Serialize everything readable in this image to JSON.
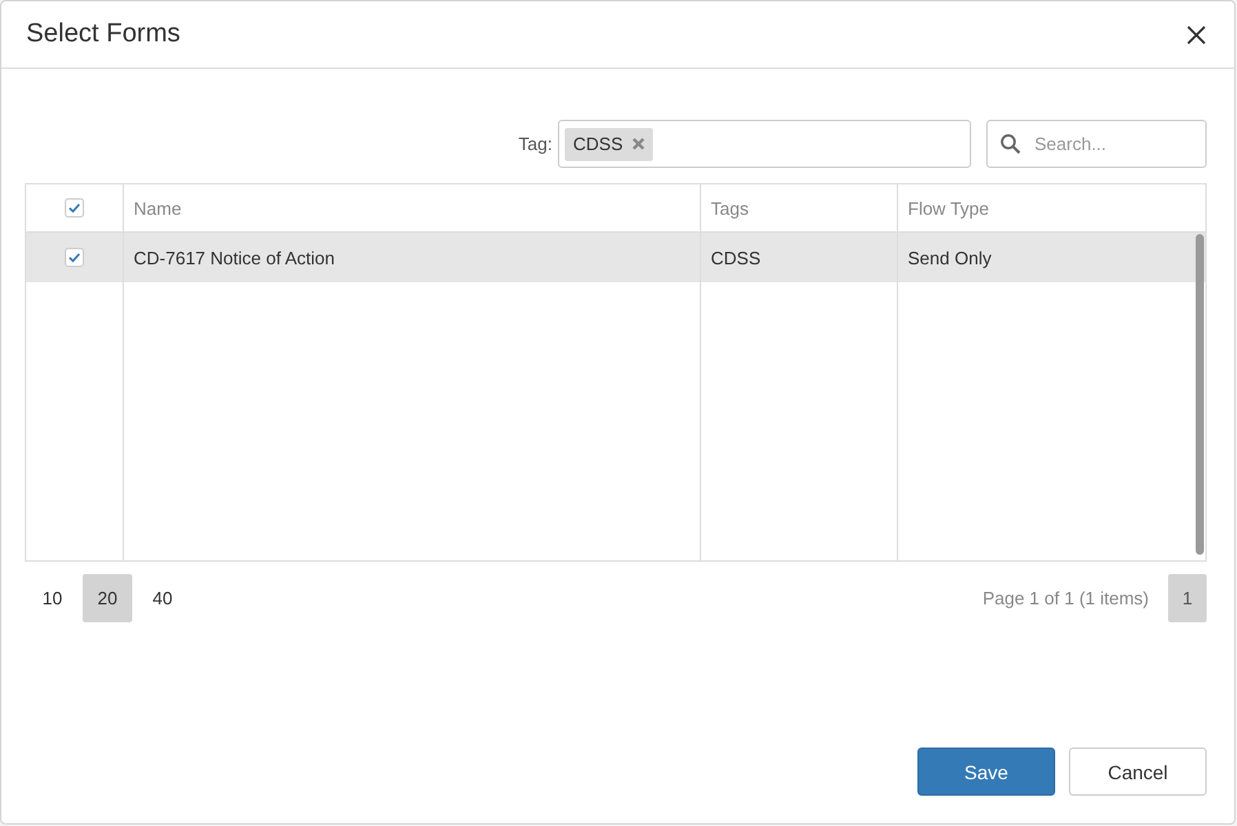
{
  "dialog": {
    "title": "Select Forms"
  },
  "filter": {
    "label": "Tag:",
    "tags": [
      {
        "label": "CDSS"
      }
    ],
    "search": {
      "placeholder": "Search..."
    }
  },
  "table": {
    "select_all": {
      "checked": true
    },
    "columns": [
      "Name",
      "Tags",
      "Flow Type"
    ],
    "rows": [
      {
        "checked": true,
        "selected": true,
        "cells": [
          "CD-7617 Notice of Action",
          "CDSS",
          "Send Only"
        ]
      }
    ]
  },
  "pager": {
    "sizes": [
      {
        "label": "10",
        "selected": false
      },
      {
        "label": "20",
        "selected": true
      },
      {
        "label": "40",
        "selected": false
      }
    ],
    "info": "Page 1 of 1 (1 items)",
    "pages": [
      {
        "label": "1",
        "selected": true
      }
    ]
  },
  "buttons": [
    {
      "label": "Save",
      "kind": "primary"
    },
    {
      "label": "Cancel",
      "kind": "default"
    }
  ]
}
